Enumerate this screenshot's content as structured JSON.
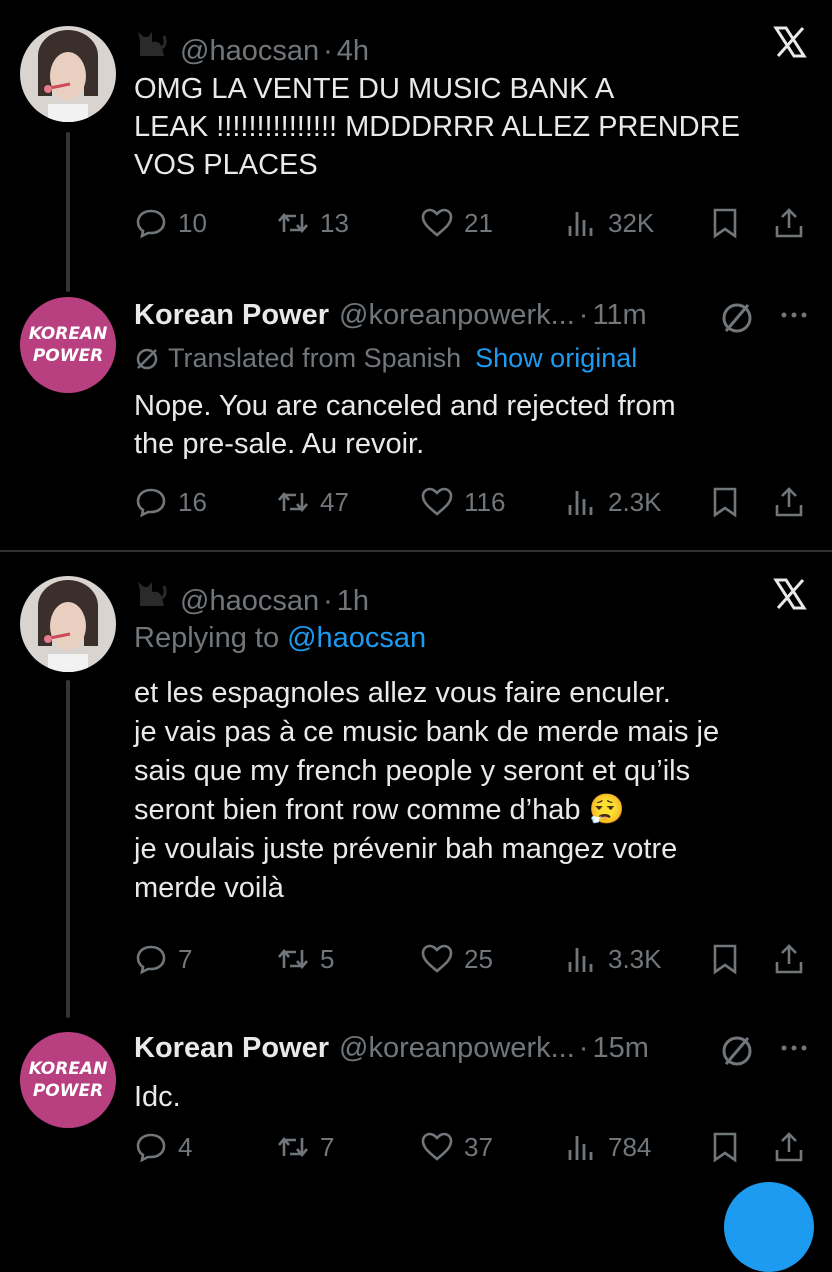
{
  "tweets": [
    {
      "display_name": "",
      "handle": "@haocsan",
      "dot": "·",
      "time": "4h",
      "reply_to_prefix": "",
      "reply_to_handle": "",
      "body": [
        "OMG LA VENTE DU MUSIC BANK A",
        "LEAK !!!!!!!!!!!!!!! MDDDRRR ALLEZ PRENDRE",
        "VOS PLACES"
      ],
      "stats": {
        "replies": "10",
        "reposts": "13",
        "likes": "21",
        "views": "32K"
      }
    },
    {
      "display_name": "Korean Power",
      "handle": "@koreanpowerk...",
      "dot": "·",
      "time": "11m",
      "translated_label": "Translated from Spanish",
      "show_original": "Show original",
      "body": [
        "Nope. You are canceled and rejected from",
        "the pre-sale. Au revoir."
      ],
      "stats": {
        "replies": "16",
        "reposts": "47",
        "likes": "116",
        "views": "2.3K"
      }
    },
    {
      "display_name": "",
      "handle": "@haocsan",
      "dot": "·",
      "time": "1h",
      "reply_to_prefix": "Replying to",
      "reply_to_handle": "@haocsan",
      "body": [
        "et les espagnoles allez vous faire enculer.",
        "je vais pas à ce music bank de merde mais je",
        "sais que my french people y seront et qu’ils",
        "seront bien front row comme d’hab 😮‍💨",
        "je voulais juste prévenir bah mangez votre",
        "merde voilà"
      ],
      "stats": {
        "replies": "7",
        "reposts": "5",
        "likes": "25",
        "views": "3.3K"
      }
    },
    {
      "display_name": "Korean Power",
      "handle": "@koreanpowerk...",
      "dot": "·",
      "time": "15m",
      "body": [
        "Idc."
      ],
      "stats": {
        "replies": "4",
        "reposts": "7",
        "likes": "37",
        "views": "784"
      }
    }
  ],
  "logo_text": [
    "KOREAN",
    "POWER"
  ],
  "colors": {
    "background": "#000000",
    "muted": "#71767b",
    "link": "#1d9bf0",
    "logo_bg": "#b94080"
  },
  "icons": [
    "cat-icon",
    "x-logo-icon",
    "reply-icon",
    "repost-icon",
    "like-icon",
    "views-icon",
    "bookmark-icon",
    "share-icon",
    "block-icon",
    "more-icon"
  ]
}
